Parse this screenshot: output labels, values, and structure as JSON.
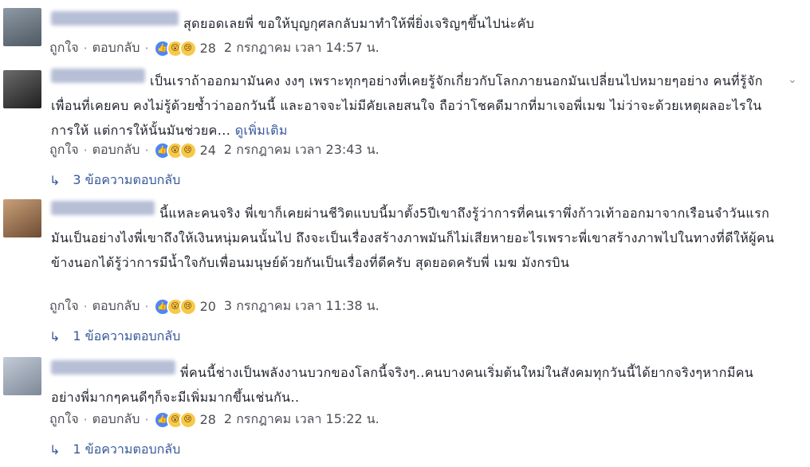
{
  "colors": {
    "link": "#365899",
    "meta": "#4b4f56",
    "like": "#4e86f3",
    "emoji": "#f7c94a"
  },
  "actions": {
    "like": "ถูกใจ",
    "reply": "ตอบกลับ",
    "sep": "·"
  },
  "comments": [
    {
      "text": "สุดยอดเลยพี่ ขอให้บุญกุศลกลับมาทำให้พี่ยิ่งเจริญๆขึ้นไปน่ะคับ",
      "count": "28",
      "time": "2 กรกฎาคม เวลา 14:57 น.",
      "avatar_color": "#6f7b86"
    },
    {
      "text": "เป็นเราถ้าออกมามันคง งงๆ เพราะทุกๆอย่างที่เคยรู้จักเกี่ยวกับโลกภายนอกมันเปลี่ยนไปหมายๆอย่าง คนที่รู้จัก เพื่อนที่เคยคบ คงไม่รู้ด้วยซ้ำว่าออกวันนี้ และอาจจะไม่มีคัยเลยสนใจ ถือว่าโชคดีมากที่มาเจอพี่เมฆ ไม่ว่าจะด้วยเหตุผลอะไรในการให้ แต่การให้นั้นมันช่วยค...",
      "see_more": "ดูเพิ่มเติม",
      "count": "24",
      "time": "2 กรกฎาคม เวลา 23:43 น.",
      "replies": "3 ข้อความตอบกลับ",
      "avatar_color": "#3d3d3d"
    },
    {
      "text": "นี้แหละคนจริง พี่เขาก็เคยผ่านชีวิตแบบนี้มาตั้ง5ปีเขาถึงรู้ว่าการที่คนเราพึ่งก้าวเท้าออกมาจากเรือนจำวันแรกมันเป็นอย่างไงพี่เขาถึงให้เงินหนุ่มคนนั้นไป ถึงจะเป็นเรื่องสร้างภาพมันก็ไม่เสียหายอะไรเพราะพี่เขาสร้างภาพไปในทางที่ดีให้ผู้คนข้างนอกได้รู้ว่าการมีน้ำใจกับเพื่อนมนุษย์ด้วยกันเป็นเรื่องที่ดีครับ สุดยอดครับพี่ เมฆ มังกรบิน",
      "count": "20",
      "time": "3 กรกฎาคม เวลา 11:38 น.",
      "replies": "1 ข้อความตอบกลับ",
      "avatar_color": "#a77a5a"
    },
    {
      "text": "พี่คนนี้ช่างเป็นพลังงานบวกของโลกนี้จริงๆ..คนบางคนเริ่มต้นใหม่ในสังคมทุกวันนี้ได้ยากจริงๆหากมีคนอย่างพี่มากๆคนดีๆก็จะมีเพิ่มมากขึ้นเช่นกัน..",
      "count": "28",
      "time": "2 กรกฎาคม เวลา 15:22 น.",
      "replies": "1 ข้อความตอบกลับ",
      "avatar_color": "#9aa6b8"
    }
  ]
}
